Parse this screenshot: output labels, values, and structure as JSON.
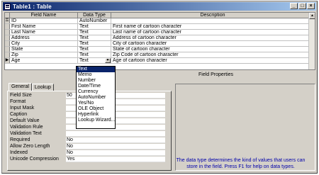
{
  "window": {
    "title": "Table1 : Table"
  },
  "grid": {
    "headers": {
      "field_name": "Field Name",
      "data_type": "Data Type",
      "description": "Description"
    },
    "rows": [
      {
        "name": "ID",
        "type": "AutoNumber",
        "desc": ""
      },
      {
        "name": "First Name",
        "type": "Text",
        "desc": "First name of cartoon character"
      },
      {
        "name": "Last Name",
        "type": "Text",
        "desc": "Last name of cartoon character"
      },
      {
        "name": "Address",
        "type": "Text",
        "desc": "Address of cartoon character"
      },
      {
        "name": "City",
        "type": "Text",
        "desc": "City of cartoon character"
      },
      {
        "name": "State",
        "type": "Text",
        "desc": "State of cartoon character"
      },
      {
        "name": "Zip",
        "type": "Text",
        "desc": "Zip Code of cartoon character"
      },
      {
        "name": "Age",
        "type": "Text",
        "desc": "Age of cartoon character"
      }
    ]
  },
  "dropdown": {
    "options": [
      "Text",
      "Memo",
      "Number",
      "Date/Time",
      "Currency",
      "AutoNumber",
      "Yes/No",
      "OLE Object",
      "Hyperlink",
      "Lookup Wizard..."
    ],
    "highlighted": "Text"
  },
  "field_properties": {
    "title": "Field Properties",
    "tabs": [
      "General",
      "Lookup"
    ],
    "properties": [
      {
        "label": "Field Size",
        "value": "50"
      },
      {
        "label": "Format",
        "value": ""
      },
      {
        "label": "Input Mask",
        "value": ""
      },
      {
        "label": "Caption",
        "value": ""
      },
      {
        "label": "Default Value",
        "value": ""
      },
      {
        "label": "Validation Rule",
        "value": ""
      },
      {
        "label": "Validation Text",
        "value": ""
      },
      {
        "label": "Required",
        "value": "No"
      },
      {
        "label": "Allow Zero Length",
        "value": "No"
      },
      {
        "label": "Indexed",
        "value": "No"
      },
      {
        "label": "Unicode Compression",
        "value": "Yes"
      }
    ],
    "help_text": "The data type determines the kind of values that users can store in the field.  Press F1 for help on data types."
  },
  "icons": {
    "key": "key-icon",
    "row_pointer": "row-pointer-icon",
    "menu": "table-icon"
  },
  "colors": {
    "titlebar": "#0a246a",
    "selection": "#0a246a",
    "help_text": "#0000aa",
    "chrome": "#d4d0c8"
  }
}
